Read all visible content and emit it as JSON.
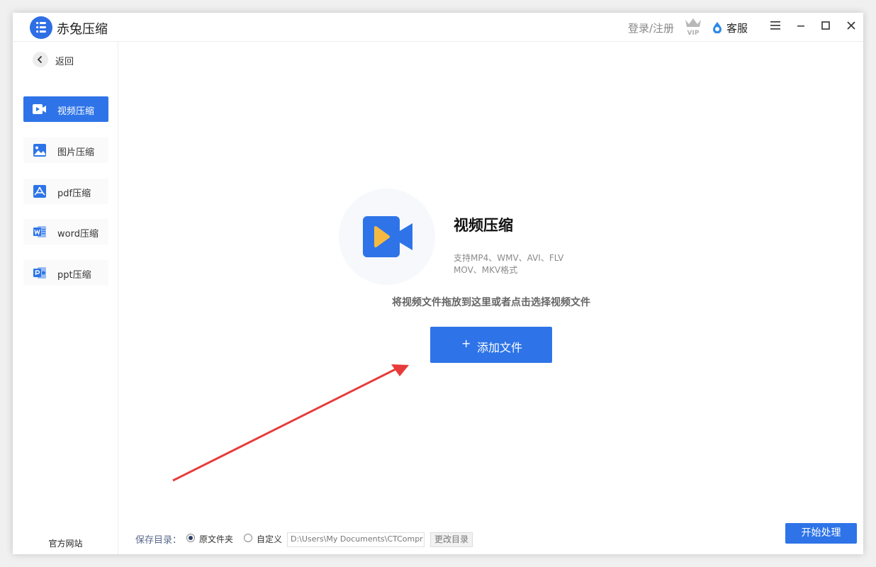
{
  "app": {
    "title": "赤兔压缩"
  },
  "header": {
    "login_label": "登录/注册",
    "vip_label": "VIP",
    "support_label": "客服",
    "menu_icon": "hamburger-icon",
    "minimize_icon": "minimize-icon",
    "maximize_icon": "maximize-icon",
    "close_icon": "close-icon"
  },
  "sidebar": {
    "back_label": "返回",
    "items": [
      {
        "label": "视频压缩",
        "icon": "video-icon",
        "active": true
      },
      {
        "label": "图片压缩",
        "icon": "image-icon",
        "active": false
      },
      {
        "label": "pdf压缩",
        "icon": "pdf-icon",
        "active": false
      },
      {
        "label": "word压缩",
        "icon": "word-icon",
        "active": false
      },
      {
        "label": "ppt压缩",
        "icon": "ppt-icon",
        "active": false
      }
    ],
    "official_site": "官方网站"
  },
  "main": {
    "title": "视频压缩",
    "subtitle_line1": "支持MP4、WMV、AVI、FLV",
    "subtitle_line2": "MOV、MKV格式",
    "drop_hint": "将视频文件拖放到这里或者点击选择视频文件",
    "add_button_plus": "+",
    "add_button_label": "添加文件"
  },
  "footer": {
    "save_dir_label": "保存目录：",
    "option_original": "原文件夹",
    "option_custom": "自定义",
    "selected_option": "原文件夹",
    "path_value": "D:\\Users\\My Documents\\CTCompr",
    "change_dir_label": "更改目录",
    "start_label": "开始处理"
  },
  "colors": {
    "accent": "#2e74e8",
    "arrow": "#e83a3a",
    "hero_icon_bg": "#2e74e8",
    "hero_play": "#f5b942"
  }
}
